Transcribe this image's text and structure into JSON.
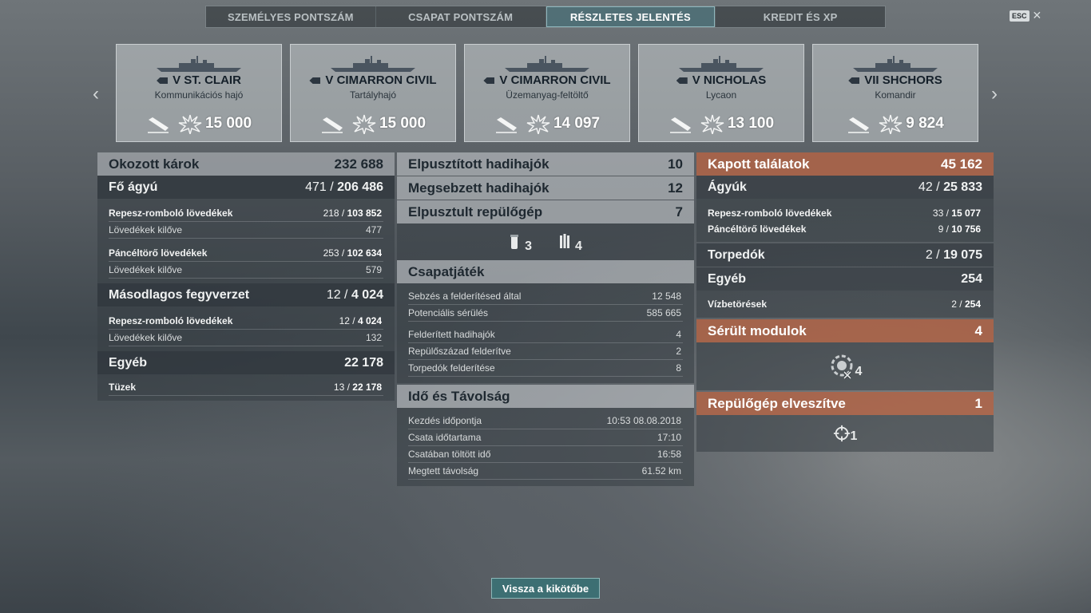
{
  "tabs": [
    "SZEMÉLYES PONTSZÁM",
    "CSAPAT PONTSZÁM",
    "RÉSZLETES JELENTÉS",
    "KREDIT ÉS XP"
  ],
  "active_tab": 2,
  "esc_label": "ESC",
  "ships": [
    {
      "tier_name": "V ST. CLAIR",
      "type": "Kommunikációs hajó",
      "score": "15 000"
    },
    {
      "tier_name": "V CIMARRON CIVIL",
      "type": "Tartályhajó",
      "score": "15 000"
    },
    {
      "tier_name": "V CIMARRON CIVIL",
      "type": "Üzemanyag-feltöltő",
      "score": "14 097"
    },
    {
      "tier_name": "V NICHOLAS",
      "type": "Lycaon",
      "score": "13 100"
    },
    {
      "tier_name": "VII SHCHORS",
      "type": "Komandir",
      "score": "9 824"
    }
  ],
  "damage": {
    "title": "Okozott károk",
    "total": "232 688",
    "main_guns": {
      "label": "Fő ágyú",
      "hits": "471",
      "dmg": "206 486"
    },
    "he": {
      "label": "Repesz-romboló lövedékek",
      "hits": "218",
      "dmg": "103 852"
    },
    "he_fired": {
      "label": "Lövedékek kilőve",
      "value": "477"
    },
    "ap": {
      "label": "Páncéltörő lövedékek",
      "hits": "253",
      "dmg": "102 634"
    },
    "ap_fired": {
      "label": "Lövedékek kilőve",
      "value": "579"
    },
    "secondary": {
      "label": "Másodlagos fegyverzet",
      "hits": "12",
      "dmg": "4 024"
    },
    "sec_he": {
      "label": "Repesz-romboló lövedékek",
      "hits": "12",
      "dmg": "4 024"
    },
    "sec_fired": {
      "label": "Lövedékek kilőve",
      "value": "132"
    },
    "other": {
      "label": "Egyéb",
      "value": "22 178"
    },
    "fires": {
      "label": "Tüzek",
      "hits": "13",
      "dmg": "22 178"
    }
  },
  "middle": {
    "destroyed_ships": {
      "label": "Elpusztított hadihajók",
      "value": "10"
    },
    "damaged_ships": {
      "label": "Megsebzett hadihajók",
      "value": "12"
    },
    "planes_destroyed": {
      "label": "Elpusztult repülőgép",
      "value": "7"
    },
    "plane_icon_a": "3",
    "plane_icon_b": "4",
    "teamplay": {
      "title": "Csapatjáték",
      "rows": [
        {
          "label": "Sebzés a felderítésed által",
          "value": "12 548"
        },
        {
          "label": "Potenciális sérülés",
          "value": "585 665"
        },
        {
          "label": "Felderített hadihajók",
          "value": "4"
        },
        {
          "label": "Repülőszázad felderítve",
          "value": "2"
        },
        {
          "label": "Torpedók felderítése",
          "value": "8"
        }
      ]
    },
    "time": {
      "title": "Idő és Távolság",
      "rows": [
        {
          "label": "Kezdés időpontja",
          "value": "10:53  08.08.2018"
        },
        {
          "label": "Csata időtartama",
          "value": "17:10"
        },
        {
          "label": "Csatában töltött idő",
          "value": "16:58"
        },
        {
          "label": "Megtett távolság",
          "value": "61.52 km"
        }
      ]
    }
  },
  "received": {
    "title": "Kapott találatok",
    "total": "45 162",
    "guns": {
      "label": "Ágyúk",
      "hits": "42",
      "dmg": "25 833"
    },
    "he": {
      "label": "Repesz-romboló lövedékek",
      "hits": "33",
      "dmg": "15 077"
    },
    "ap": {
      "label": "Páncéltörő lövedékek",
      "hits": "9",
      "dmg": "10 756"
    },
    "torpedoes": {
      "label": "Torpedók",
      "hits": "2",
      "dmg": "19 075"
    },
    "other": {
      "label": "Egyéb",
      "value": "254"
    },
    "flooding": {
      "label": "Vízbetörések",
      "hits": "2",
      "dmg": "254"
    },
    "modules": {
      "label": "Sérült modulok",
      "value": "4",
      "icon_count": "4"
    },
    "planes_lost": {
      "label": "Repülőgép elveszítve",
      "value": "1",
      "icon_count": "1"
    }
  },
  "return_button": "Vissza a kikötőbe",
  "colors": {
    "accent": "#3d6f73",
    "received_header": "#b0644a"
  }
}
